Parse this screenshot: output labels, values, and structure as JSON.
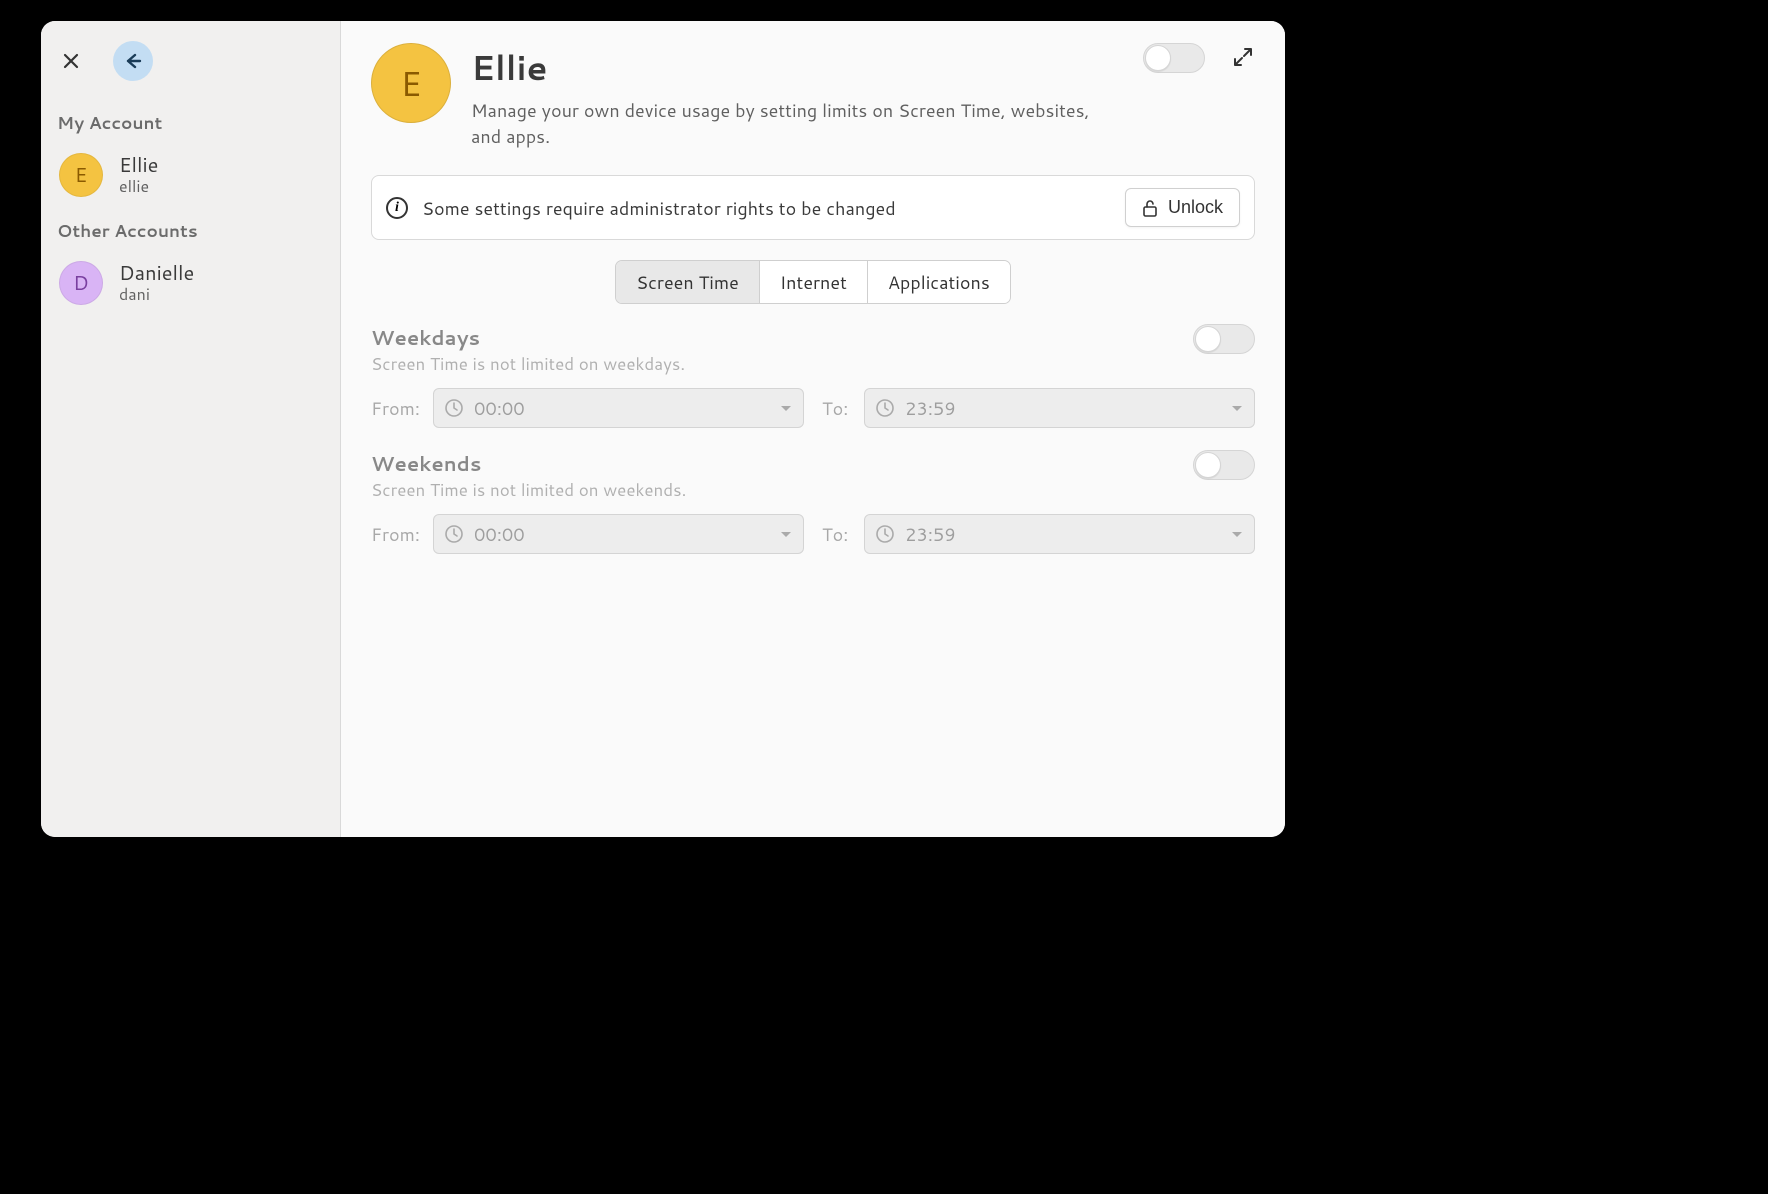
{
  "sidebar": {
    "my_account_heading": "My Account",
    "other_accounts_heading": "Other Accounts",
    "accounts": [
      {
        "initial": "E",
        "name": "Ellie",
        "sub": "ellie",
        "color": "#f4c341",
        "text": "#8a5a00"
      },
      {
        "initial": "D",
        "name": "Danielle",
        "sub": "dani",
        "color": "#d9b4f5",
        "text": "#7a3fa0"
      }
    ]
  },
  "header": {
    "avatar_initial": "E",
    "avatar_color": "#f4c341",
    "title": "Ellie",
    "subtitle": "Manage your own device usage by setting limits on Screen Time, websites, and apps."
  },
  "notice": {
    "text": "Some settings require administrator rights to be changed",
    "unlock_label": "Unlock"
  },
  "tabs": [
    {
      "label": "Screen Time",
      "active": true
    },
    {
      "label": "Internet",
      "active": false
    },
    {
      "label": "Applications",
      "active": false
    }
  ],
  "sections": {
    "weekdays": {
      "title": "Weekdays",
      "sub": "Screen Time is not limited on weekdays.",
      "from_label": "From:",
      "from_value": "00:00",
      "to_label": "To:",
      "to_value": "23:59"
    },
    "weekends": {
      "title": "Weekends",
      "sub": "Screen Time is not limited on weekends.",
      "from_label": "From:",
      "from_value": "00:00",
      "to_label": "To:",
      "to_value": "23:59"
    }
  }
}
